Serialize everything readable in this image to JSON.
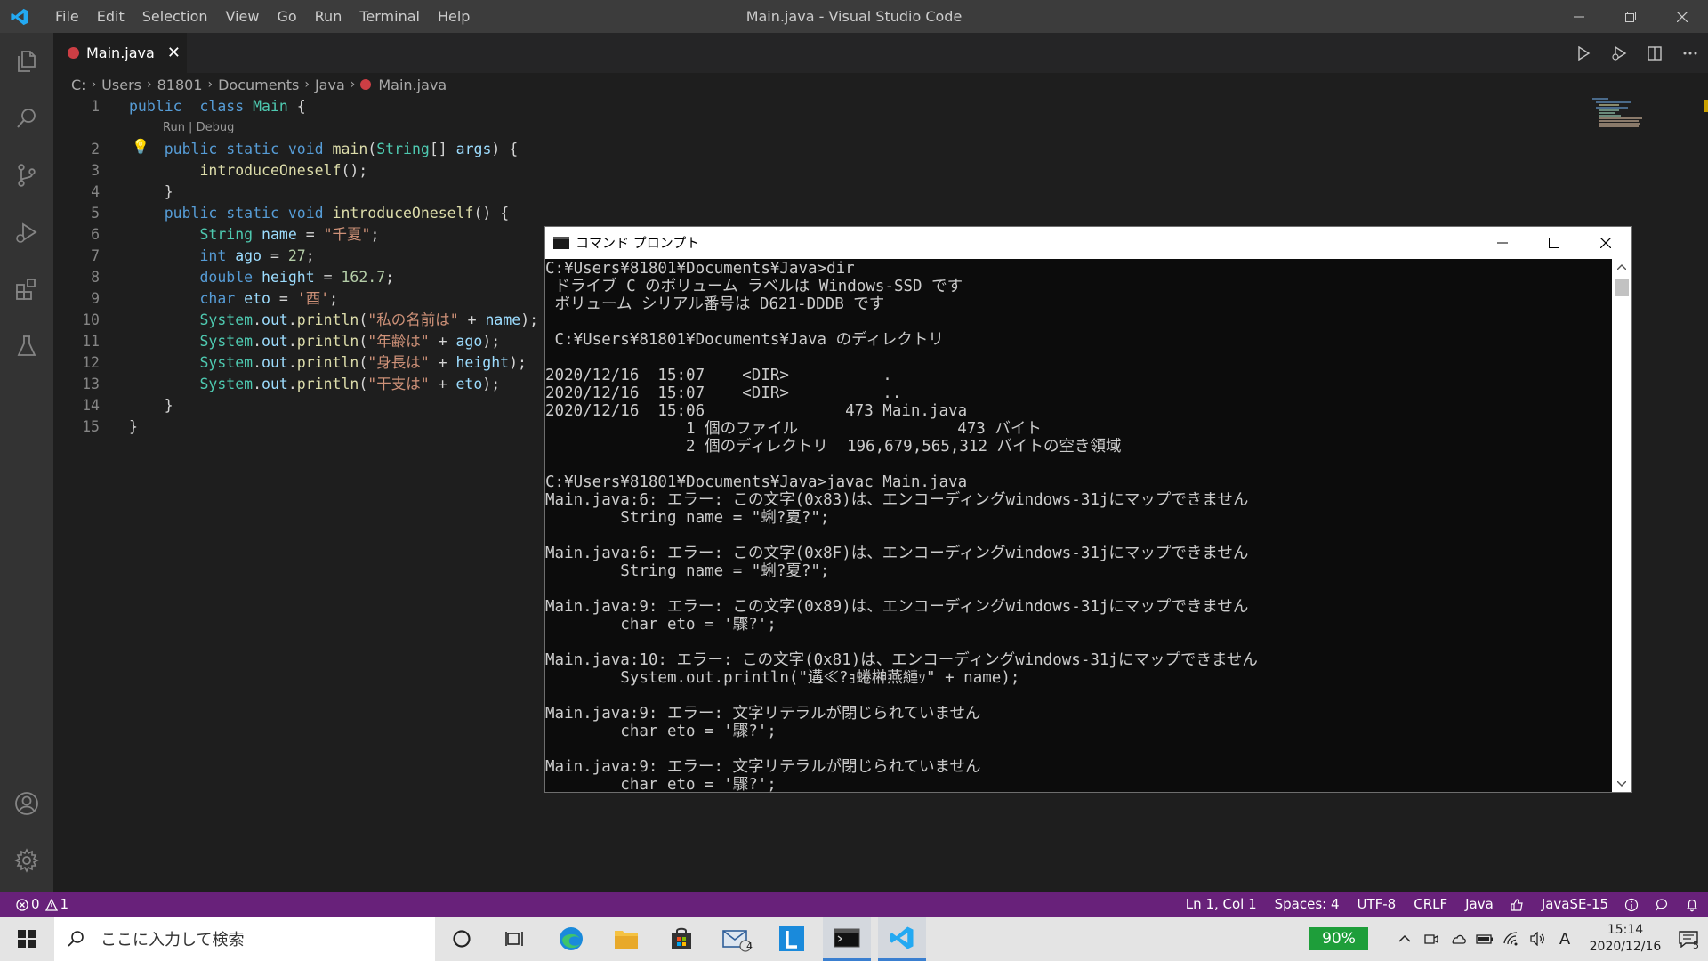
{
  "window": {
    "menu": [
      "File",
      "Edit",
      "Selection",
      "View",
      "Go",
      "Run",
      "Terminal",
      "Help"
    ],
    "title": "Main.java - Visual Studio Code"
  },
  "tab": {
    "label": "Main.java",
    "close": "✕"
  },
  "breadcrumb": [
    "C:",
    "Users",
    "81801",
    "Documents",
    "Java",
    "Main.java"
  ],
  "editor": {
    "line_numbers": [
      "1",
      "2",
      "3",
      "4",
      "5",
      "6",
      "7",
      "8",
      "9",
      "10",
      "11",
      "12",
      "13",
      "14",
      "15"
    ],
    "codelens": "Run | Debug",
    "lines": [
      [
        [
          "kw",
          "public"
        ],
        [
          "",
          "  "
        ],
        [
          "kw",
          "class"
        ],
        [
          "",
          " "
        ],
        [
          "ty",
          "Main"
        ],
        [
          "",
          " {"
        ]
      ],
      [
        [
          "",
          ""
        ]
      ],
      [
        [
          "",
          "    "
        ],
        [
          "kw",
          "public"
        ],
        [
          "",
          " "
        ],
        [
          "kw",
          "static"
        ],
        [
          "",
          " "
        ],
        [
          "kw",
          "void"
        ],
        [
          "",
          " "
        ],
        [
          "fn",
          "main"
        ],
        [
          "",
          "("
        ],
        [
          "ty",
          "String"
        ],
        [
          "",
          "[] "
        ],
        [
          "vr",
          "args"
        ],
        [
          "",
          ") {"
        ]
      ],
      [
        [
          "",
          "        "
        ],
        [
          "fn",
          "introduceOneself"
        ],
        [
          "",
          "();"
        ]
      ],
      [
        [
          "",
          "    }"
        ]
      ],
      [
        [
          "",
          "    "
        ],
        [
          "kw",
          "public"
        ],
        [
          "",
          " "
        ],
        [
          "kw",
          "static"
        ],
        [
          "",
          " "
        ],
        [
          "kw",
          "void"
        ],
        [
          "",
          " "
        ],
        [
          "fn",
          "introduceOneself"
        ],
        [
          "",
          "() {"
        ]
      ],
      [
        [
          "",
          "        "
        ],
        [
          "ty",
          "String"
        ],
        [
          "",
          " "
        ],
        [
          "vr",
          "name"
        ],
        [
          "",
          " = "
        ],
        [
          "st",
          "\"千夏\""
        ],
        [
          "",
          ";"
        ]
      ],
      [
        [
          "",
          "        "
        ],
        [
          "kw",
          "int"
        ],
        [
          "",
          " "
        ],
        [
          "vr",
          "ago"
        ],
        [
          "",
          " = "
        ],
        [
          "nm",
          "27"
        ],
        [
          "",
          ";"
        ]
      ],
      [
        [
          "",
          "        "
        ],
        [
          "kw",
          "double"
        ],
        [
          "",
          " "
        ],
        [
          "vr",
          "height"
        ],
        [
          "",
          " = "
        ],
        [
          "nm",
          "162.7"
        ],
        [
          "",
          ";"
        ]
      ],
      [
        [
          "",
          "        "
        ],
        [
          "kw",
          "char"
        ],
        [
          "",
          " "
        ],
        [
          "vr",
          "eto"
        ],
        [
          "",
          " = "
        ],
        [
          "st",
          "'酉'"
        ],
        [
          "",
          ";"
        ]
      ],
      [
        [
          "",
          "        "
        ],
        [
          "ty",
          "System"
        ],
        [
          "",
          "."
        ],
        [
          "vr",
          "out"
        ],
        [
          "",
          "."
        ],
        [
          "fn",
          "println"
        ],
        [
          "",
          "("
        ],
        [
          "st",
          "\"私の名前は\""
        ],
        [
          "",
          " + "
        ],
        [
          "vr",
          "name"
        ],
        [
          "",
          ");"
        ]
      ],
      [
        [
          "",
          "        "
        ],
        [
          "ty",
          "System"
        ],
        [
          "",
          "."
        ],
        [
          "vr",
          "out"
        ],
        [
          "",
          "."
        ],
        [
          "fn",
          "println"
        ],
        [
          "",
          "("
        ],
        [
          "st",
          "\"年齢は\""
        ],
        [
          "",
          " + "
        ],
        [
          "vr",
          "ago"
        ],
        [
          "",
          ");"
        ]
      ],
      [
        [
          "",
          "        "
        ],
        [
          "ty",
          "System"
        ],
        [
          "",
          "."
        ],
        [
          "vr",
          "out"
        ],
        [
          "",
          "."
        ],
        [
          "fn",
          "println"
        ],
        [
          "",
          "("
        ],
        [
          "st",
          "\"身長は\""
        ],
        [
          "",
          " + "
        ],
        [
          "vr",
          "height"
        ],
        [
          "",
          ");"
        ]
      ],
      [
        [
          "",
          "        "
        ],
        [
          "ty",
          "System"
        ],
        [
          "",
          "."
        ],
        [
          "vr",
          "out"
        ],
        [
          "",
          "."
        ],
        [
          "fn",
          "println"
        ],
        [
          "",
          "("
        ],
        [
          "st",
          "\"干支は\""
        ],
        [
          "",
          " + "
        ],
        [
          "vr",
          "eto"
        ],
        [
          "",
          ");"
        ]
      ],
      [
        [
          "",
          "    }"
        ]
      ],
      [
        [
          "",
          "}"
        ]
      ]
    ]
  },
  "cmd": {
    "title": "コマンド プロンプト",
    "lines": [
      "C:¥Users¥81801¥Documents¥Java>dir",
      " ドライブ C のボリューム ラベルは Windows-SSD です",
      " ボリューム シリアル番号は D621-DDDB です",
      "",
      " C:¥Users¥81801¥Documents¥Java のディレクトリ",
      "",
      "2020/12/16  15:07    <DIR>          .",
      "2020/12/16  15:07    <DIR>          ..",
      "2020/12/16  15:06               473 Main.java",
      "               1 個のファイル                 473 バイト",
      "               2 個のディレクトリ  196,679,565,312 バイトの空き領域",
      "",
      "C:¥Users¥81801¥Documents¥Java>javac Main.java",
      "Main.java:6: エラー: この文字(0x83)は、エンコーディングwindows-31jにマップできません",
      "        String name = \"蜊?夏?\";",
      "",
      "Main.java:6: エラー: この文字(0x8F)は、エンコーディングwindows-31jにマップできません",
      "        String name = \"蜊?夏?\";",
      "",
      "Main.java:9: エラー: この文字(0x89)は、エンコーディングwindows-31jにマップできません",
      "        char eto = '驟?';",
      "",
      "Main.java:10: エラー: この文字(0x81)は、エンコーディングwindows-31jにマップできません",
      "        System.out.println(\"遘≪?ｮ蜷榊燕縺ｯ\" + name);",
      "",
      "Main.java:9: エラー: 文字リテラルが閉じられていません",
      "        char eto = '驟?';",
      "",
      "Main.java:9: エラー: 文字リテラルが閉じられていません",
      "        char eto = '驟?';"
    ]
  },
  "status": {
    "errors": "0",
    "warnings": "1",
    "position": "Ln 1, Col 1",
    "spaces": "Spaces: 4",
    "encoding": "UTF-8",
    "eol": "CRLF",
    "language": "Java",
    "runtime": "JavaSE-15"
  },
  "taskbar": {
    "search_placeholder": "ここに入力して検索",
    "mail_badge": "4",
    "battery": "90%",
    "ime": "A",
    "time": "15:14",
    "date": "2020/12/16",
    "notif_count": "5"
  },
  "colors": {
    "statusbar": "#68217a",
    "accent": "#3a7fd0",
    "battery": "#1e9e3a"
  }
}
